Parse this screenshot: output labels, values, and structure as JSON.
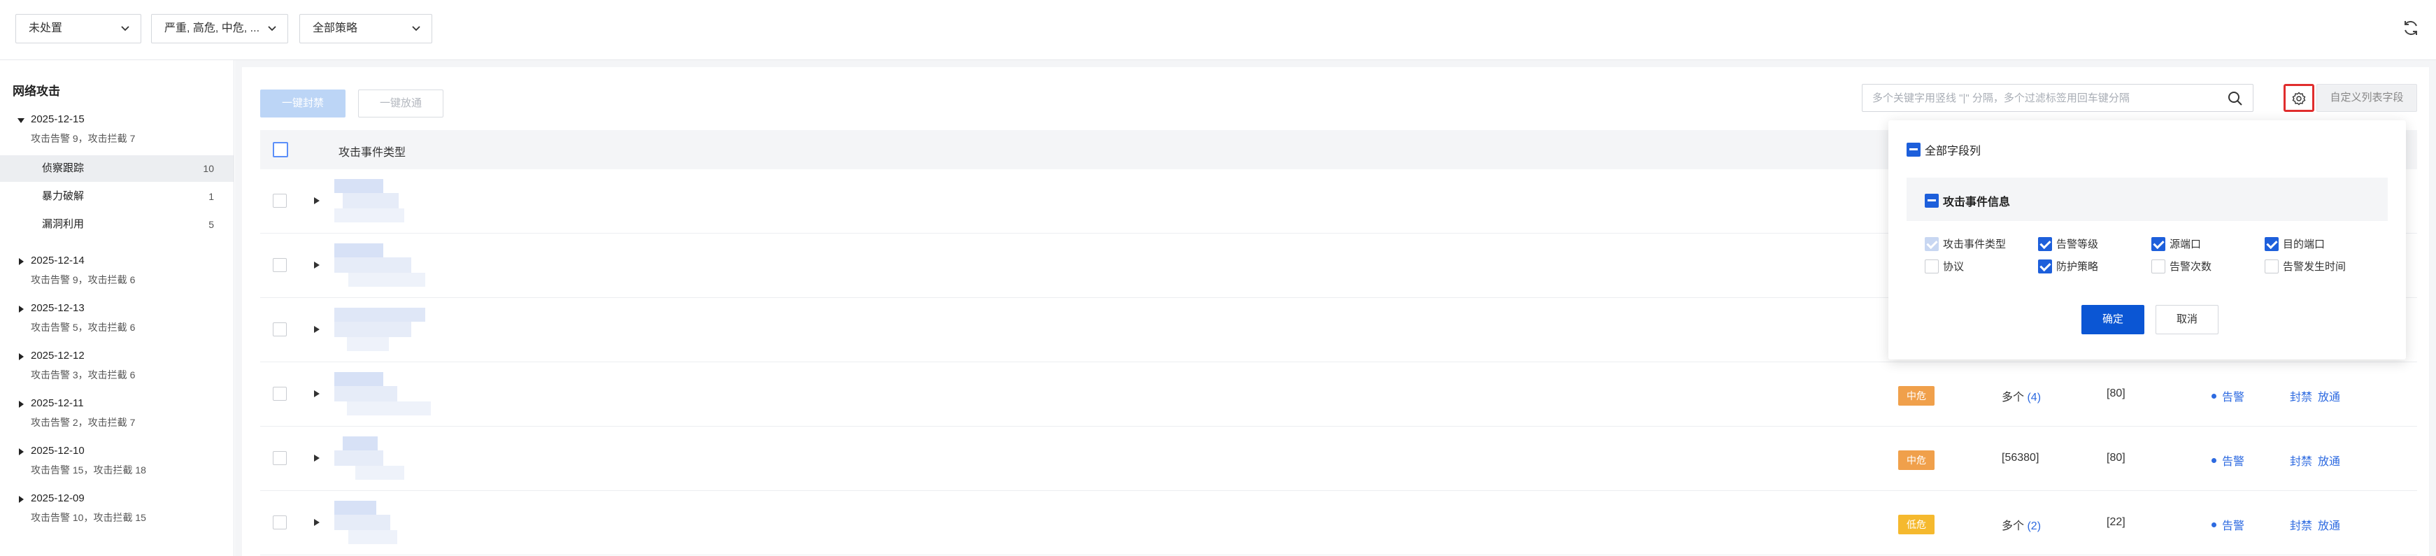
{
  "filters": {
    "status": "未处置",
    "severity": "严重, 高危, 中危, ...",
    "policy": "全部策略"
  },
  "sidebar": {
    "title": "网络攻击",
    "dates": [
      {
        "date": "2025-12-15",
        "summary": "攻击告警 9，攻击拦截 7",
        "expanded": true,
        "children": [
          {
            "label": "侦察跟踪",
            "count": "10",
            "active": true
          },
          {
            "label": "暴力破解",
            "count": "1",
            "active": false
          },
          {
            "label": "漏洞利用",
            "count": "5",
            "active": false
          }
        ]
      },
      {
        "date": "2025-12-14",
        "summary": "攻击告警 9，攻击拦截 6"
      },
      {
        "date": "2025-12-13",
        "summary": "攻击告警 5，攻击拦截 6"
      },
      {
        "date": "2025-12-12",
        "summary": "攻击告警 3，攻击拦截 6"
      },
      {
        "date": "2025-12-11",
        "summary": "攻击告警 2，攻击拦截 7"
      },
      {
        "date": "2025-12-10",
        "summary": "攻击告警 15，攻击拦截 18"
      },
      {
        "date": "2025-12-09",
        "summary": "攻击告警 10，攻击拦截 15"
      }
    ]
  },
  "toolbar": {
    "block_all": "一键封禁",
    "allow_all": "一键放通",
    "search_placeholder": "多个关键字用竖线 \"|\" 分隔，多个过滤标签用回车键分隔",
    "custom_columns": "自定义列表字段"
  },
  "table": {
    "header": "攻击事件类型",
    "rows": [
      {
        "severity": "",
        "src_port": "",
        "src_count": "",
        "dst_port": "",
        "policy": "",
        "actions": []
      },
      {
        "severity": "",
        "src_port": "",
        "src_count": "",
        "dst_port": "",
        "policy": "",
        "actions": []
      },
      {
        "severity": "",
        "src_port": "",
        "src_count": "",
        "dst_port": "",
        "policy": "",
        "actions": []
      },
      {
        "severity": "中危",
        "severity_level": "mid",
        "src_port": "多个",
        "src_count": "(4)",
        "dst_port": "[80]",
        "policy": "告警",
        "actions": [
          "封禁",
          "放通"
        ]
      },
      {
        "severity": "中危",
        "severity_level": "mid",
        "src_port": "[56380]",
        "src_count": "",
        "dst_port": "[80]",
        "policy": "告警",
        "actions": [
          "封禁",
          "放通"
        ]
      },
      {
        "severity": "低危",
        "severity_level": "low",
        "src_port": "多个",
        "src_count": "(2)",
        "dst_port": "[22]",
        "policy": "告警",
        "actions": [
          "封禁",
          "放通"
        ]
      }
    ]
  },
  "column_popover": {
    "all_label": "全部字段列",
    "group_label": "攻击事件信息",
    "fields": [
      {
        "label": "攻击事件类型",
        "state": "disabled"
      },
      {
        "label": "告警等级",
        "state": "on"
      },
      {
        "label": "源端口",
        "state": "on"
      },
      {
        "label": "目的端口",
        "state": "on"
      },
      {
        "label": "协议",
        "state": "off"
      },
      {
        "label": "防护策略",
        "state": "on"
      },
      {
        "label": "告警次数",
        "state": "off"
      },
      {
        "label": "告警发生时间",
        "state": "off"
      }
    ],
    "confirm": "确定",
    "cancel": "取消"
  },
  "colors": {
    "primary": "#0b56d4",
    "link": "#2d6ae0",
    "mid_risk": "#f0a04b",
    "low_risk": "#f5b92e",
    "highlight_border": "#e02d2d"
  }
}
